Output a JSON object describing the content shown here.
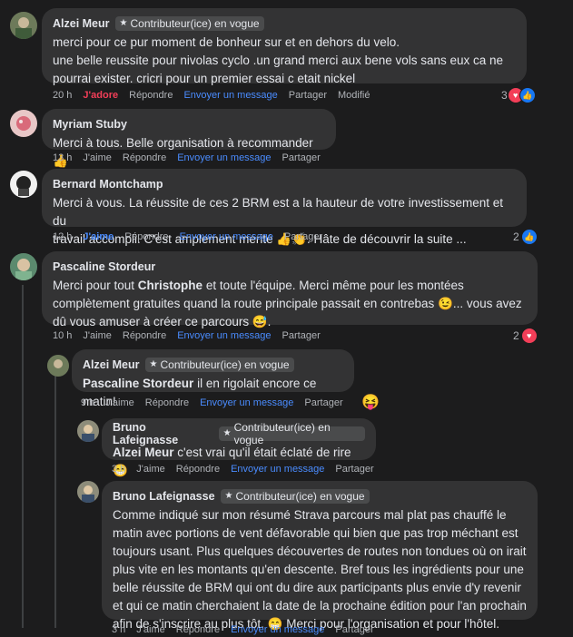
{
  "badge_label": "Contributeur(ice) en vogue",
  "actions": {
    "jadore": "J'adore",
    "jaime": "J'aime",
    "reply": "Répondre",
    "send": "Envoyer un message",
    "share": "Partager",
    "edited": "Modifié"
  },
  "comments": [
    {
      "name": "Alzei Meur",
      "text": "merci pour ce pur moment de bonheur sur et en dehors du velo.\nune belle reussite pour nivolas cyclo .un grand merci aux bene vols sans eux ca ne\npourrai exister. cricri pour un premier essai c etait nickel",
      "time": "20 h",
      "reaction_count": "3"
    },
    {
      "name": "Myriam Stuby",
      "text": "Merci à tous. Belle organisation à recommander 👍",
      "time": "13 h"
    },
    {
      "name": "Bernard Montchamp",
      "text": "Merci à vous. La réussite de ces 2 BRM est a la hauteur de votre investissement et du\ntravail accompli. C'est amplement mérité 👍👏. Hâte de découvrir la suite ...",
      "time": "12 h",
      "reaction_count": "2"
    },
    {
      "name": "Pascaline Stordeur",
      "text_before": "Merci pour tout ",
      "mention": "Christophe",
      "text_after": " et toute l'équipe. Merci même pour les montées\ncomplètement gratuites quand la route principale passait en contrebas 😉... vous avez\ndû vous amuser à créer ce parcours 😅.",
      "time": "10 h",
      "reaction_count": "2"
    },
    {
      "name": "Alzei Meur",
      "mention": "Pascaline Stordeur",
      "text_after": " il en rigolait encore ce matin!",
      "time": "9 h",
      "side_emoji": "😝"
    },
    {
      "name": "Bruno Lafeignasse",
      "mention": "Alzei Meur",
      "text_after": " c'est vrai qu'il était éclaté de rire 😁",
      "time": "3 h"
    },
    {
      "name": "Bruno Lafeignasse",
      "text": "Comme indiqué sur mon résumé Strava parcours mal plat pas chauffé le\nmatin avec portions de vent défavorable qui bien que pas trop méchant est\ntoujours usant. Plus quelques découvertes de routes non tondues où on irait\nplus vite en les montants qu'en descente. Bref tous les ingrédients pour une\nbelle réussite de BRM qui ont du dire aux participants plus envie d'y revenir\net qui ce matin cherchaient la date de la prochaine édition pour l'an prochain\nafin de s'inscrire au plus tôt. 😁 Merci pour l'organisation et pour l'hôtel.",
      "time": "3 h"
    }
  ]
}
